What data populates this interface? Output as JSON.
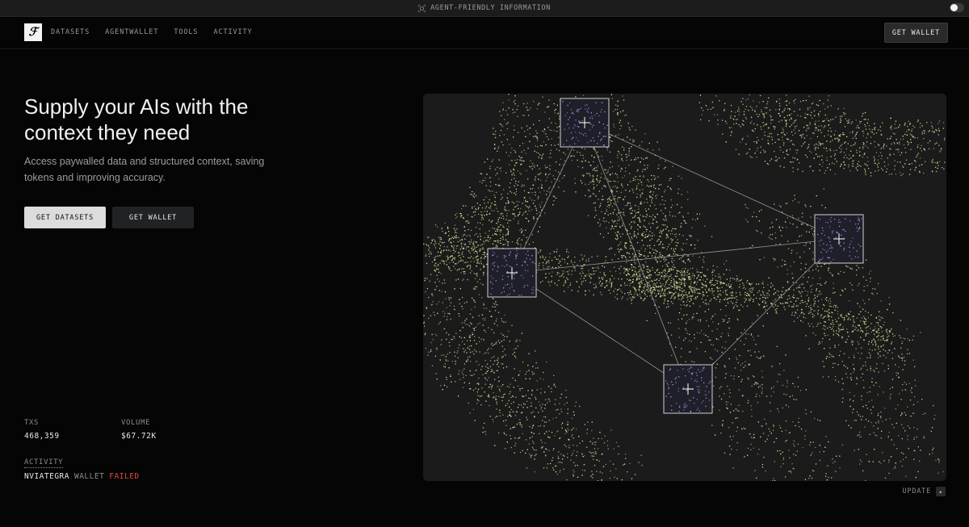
{
  "topbar": {
    "label": "AGENT-FRIENDLY INFORMATION",
    "icon": "bracket-scan-icon",
    "toggle_on": true
  },
  "nav": {
    "logo_text": "ℱ",
    "links": [
      "DATASETS",
      "AGENTWALLET",
      "TOOLS",
      "ACTIVITY"
    ],
    "cta": "GET WALLET"
  },
  "hero": {
    "title": "Supply your AIs with the context they need",
    "subtitle": "Access paywalled data and structured context, saving tokens and improving accuracy.",
    "primary_button": "GET DATASETS",
    "secondary_button": "GET WALLET"
  },
  "stats": {
    "txs_label": "TXS",
    "txs_value": "468,359",
    "volume_label": "VOLUME",
    "volume_value": "$67.72K"
  },
  "activity": {
    "label": "ACTIVITY",
    "name": "NVIATEGRA",
    "type": "WALLET",
    "status": "FAILED"
  },
  "visual": {
    "update_label": "UPDATE",
    "update_icon": "sparkle-icon",
    "colors": {
      "points": "#e6f0a0",
      "nodes": "#a9a3ff",
      "panel": "#1b1b1b"
    }
  }
}
